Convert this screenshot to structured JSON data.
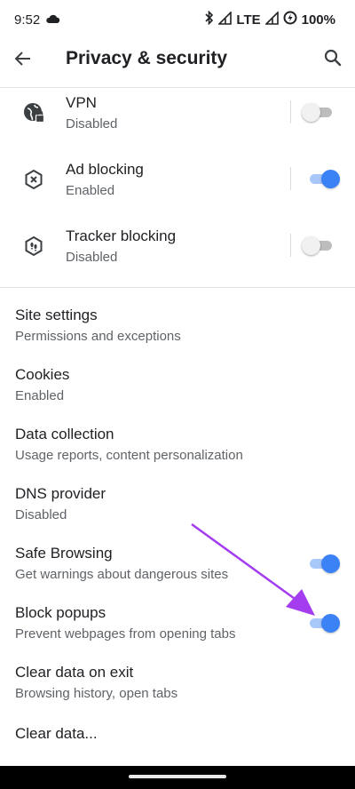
{
  "status_bar": {
    "time": "9:52",
    "network": "LTE",
    "battery": "100%",
    "icons": [
      "cloud-icon",
      "bluetooth-icon",
      "signal-icon",
      "signal-icon",
      "battery-saver-icon"
    ]
  },
  "app_bar": {
    "title": "Privacy & security",
    "back_icon": "arrow-left-icon",
    "search_icon": "search-icon"
  },
  "toggle_items": [
    {
      "title": "VPN",
      "subtitle": "Disabled",
      "icon": "globe-lock-icon",
      "enabled": false
    },
    {
      "title": "Ad blocking",
      "subtitle": "Enabled",
      "icon": "ad-block-icon",
      "enabled": true
    },
    {
      "title": "Tracker blocking",
      "subtitle": "Disabled",
      "icon": "footprints-icon",
      "enabled": false
    }
  ],
  "settings": [
    {
      "title": "Site settings",
      "subtitle": "Permissions and exceptions"
    },
    {
      "title": "Cookies",
      "subtitle": "Enabled"
    },
    {
      "title": "Data collection",
      "subtitle": "Usage reports, content personalization"
    },
    {
      "title": "DNS provider",
      "subtitle": "Disabled"
    },
    {
      "title": "Safe Browsing",
      "subtitle": "Get warnings about dangerous sites",
      "enabled": true
    },
    {
      "title": "Block popups",
      "subtitle": "Prevent webpages from opening tabs",
      "enabled": true
    },
    {
      "title": "Clear data on exit",
      "subtitle": "Browsing history, open tabs"
    },
    {
      "title": "Clear data..."
    }
  ],
  "colors": {
    "accent": "#3b82f6",
    "annotation_arrow": "#a43cf0"
  }
}
